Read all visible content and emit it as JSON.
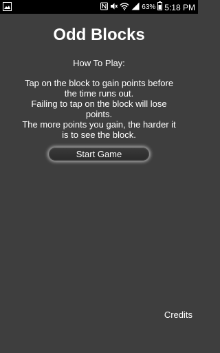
{
  "status_bar": {
    "battery_percent": "63%",
    "time": "5:18 PM",
    "icons": [
      "gallery-icon",
      "nfc-icon",
      "mute-icon",
      "wifi-icon",
      "signal-icon",
      "battery-icon"
    ]
  },
  "app": {
    "title": "Odd Blocks",
    "how_to_play_heading": "How To Play:",
    "instructions": [
      "Tap on the block to gain points before the time runs out.",
      "Failing to tap on the block will lose points.",
      "The more points you gain, the harder it is to see the block."
    ],
    "start_button_label": "Start Game",
    "credits_label": "Credits"
  },
  "colors": {
    "background": "#3e3e3e",
    "status_bar": "#000000",
    "text": "#ffffff"
  }
}
